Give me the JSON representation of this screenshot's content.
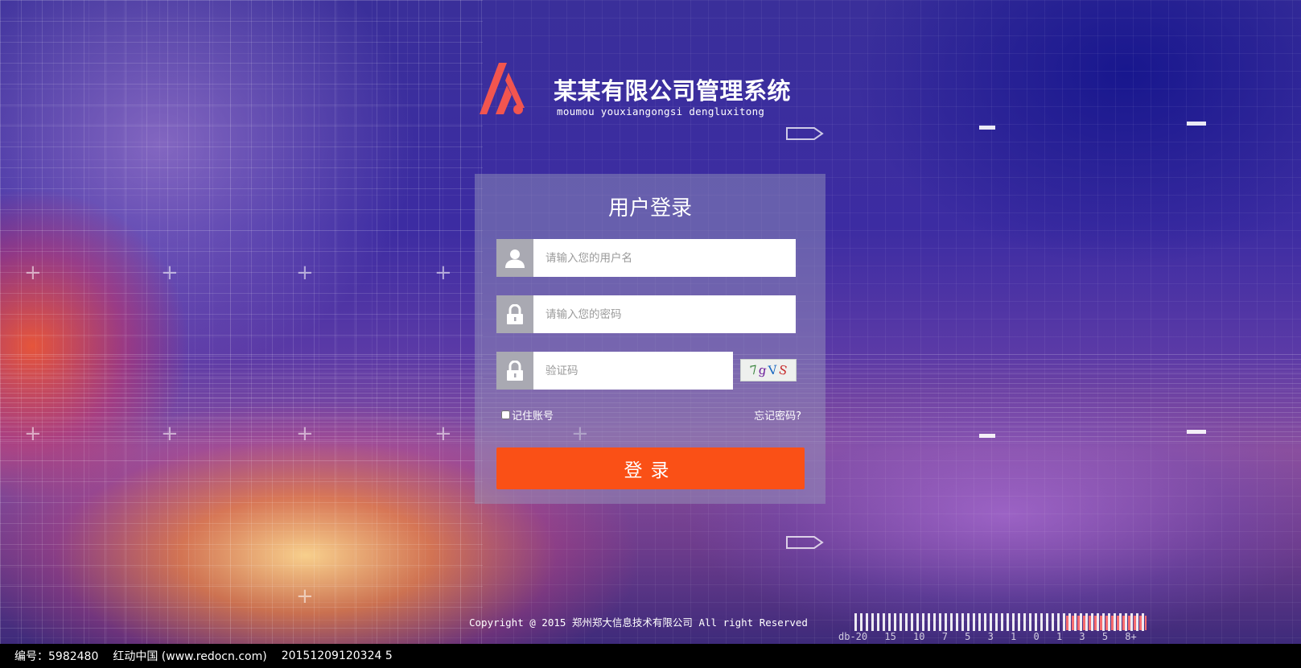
{
  "header": {
    "title": "某某有限公司管理系统",
    "subtitle": "moumou youxiangongsi dengluxitong",
    "logo_color": "#f2554f"
  },
  "login": {
    "title": "用户登录",
    "username_placeholder": "请输入您的用户名",
    "password_placeholder": "请输入您的密码",
    "captcha_placeholder": "验证码",
    "captcha_text": "7gVS",
    "remember_label": "记住账号",
    "forgot_label": "忘记密码?",
    "submit_label": "登录",
    "submit_color": "#fa5016",
    "icons": [
      "user-icon",
      "lock-icon",
      "lock-icon"
    ]
  },
  "footer": {
    "copyright": "Copyright @ 2015 郑州郑大信息技术有限公司 All right Reserved",
    "scale_labels": "db-20 15 10 7 5 3 1 0 1 3 5 8+"
  },
  "watermark": {
    "id": "编号：5982480",
    "site": "红动中国 (www.redocn.com)",
    "code": "20151209120324 5"
  }
}
